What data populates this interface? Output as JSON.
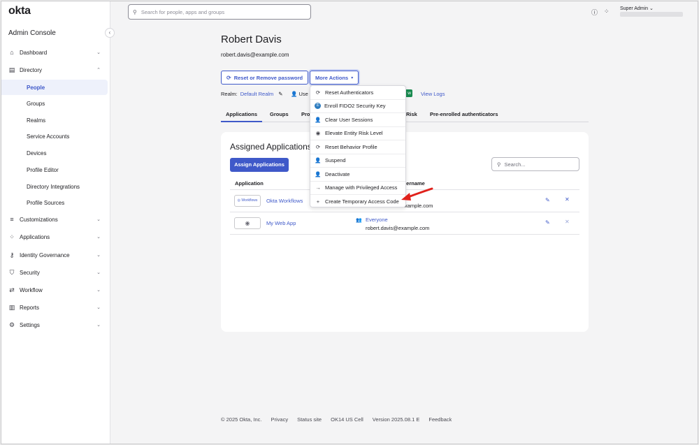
{
  "brand": {
    "logo": "okta",
    "console_title": "Admin Console",
    "accent": "#3f59c9"
  },
  "search": {
    "placeholder": "Search for people, apps and groups"
  },
  "header": {
    "role": "Super Admin"
  },
  "sidebar": {
    "items": [
      {
        "label": "Dashboard",
        "icon": "dashboard-icon"
      },
      {
        "label": "Directory",
        "icon": "directory-icon"
      },
      {
        "label": "Customizations",
        "icon": "customizations-icon"
      },
      {
        "label": "Applications",
        "icon": "applications-icon"
      },
      {
        "label": "Identity Governance",
        "icon": "identity-governance-icon"
      },
      {
        "label": "Security",
        "icon": "security-icon"
      },
      {
        "label": "Workflow",
        "icon": "workflow-icon"
      },
      {
        "label": "Reports",
        "icon": "reports-icon"
      },
      {
        "label": "Settings",
        "icon": "settings-icon"
      }
    ],
    "directory_subitems": [
      "People",
      "Groups",
      "Realms",
      "Service Accounts",
      "Devices",
      "Profile Editor",
      "Directory Integrations",
      "Profile Sources"
    ]
  },
  "profile": {
    "name": "Robert Davis",
    "email": "robert.davis@example.com",
    "reset_button": "Reset or Remove password",
    "more_actions_button": "More Actions",
    "realm_label": "Realm:",
    "realm_value": "Default Realm",
    "user_type_prefix": "Use",
    "badge_suffix": "w",
    "view_logs": "View Logs"
  },
  "tabs": [
    "Applications",
    "Groups",
    "Pro",
    "Risk",
    "Pre-enrolled authenticators"
  ],
  "more_actions_menu": [
    {
      "label": "Reset Authenticators",
      "icon": "reset-icon"
    },
    {
      "label": "Enroll FIDO2 Security Key",
      "icon": "fido-key-icon"
    },
    {
      "label": "Clear User Sessions",
      "icon": "user-icon"
    },
    {
      "label": "Elevate Entity Risk Level",
      "icon": "risk-icon"
    },
    {
      "label": "Reset Behavior Profile",
      "icon": "reset-icon"
    },
    {
      "label": "Suspend",
      "icon": "user-suspend-icon"
    },
    {
      "label": "Deactivate",
      "icon": "user-deactivate-icon"
    },
    {
      "label": "Manage with Privileged Access",
      "icon": "arrow-right-icon"
    },
    {
      "label": "Create Temporary Access Code",
      "icon": "plus-icon"
    }
  ],
  "assigned_apps": {
    "title": "Assigned Applications",
    "assign_button": "Assign Applications",
    "search_placeholder": "Search...",
    "columns": {
      "application": "Application",
      "username": "sername"
    },
    "rows": [
      {
        "logo_text": "Workflows",
        "name": "Okta Workflows",
        "assignment": "",
        "username": "xample.com"
      },
      {
        "logo_text": "",
        "name": "My Web App",
        "assignment": "Everyone",
        "username": "robert.davis@example.com"
      }
    ]
  },
  "footer": {
    "links": [
      "© 2025 Okta, Inc.",
      "Privacy",
      "Status site",
      "OK14 US Cell",
      "Version 2025.08.1 E",
      "Feedback"
    ]
  }
}
